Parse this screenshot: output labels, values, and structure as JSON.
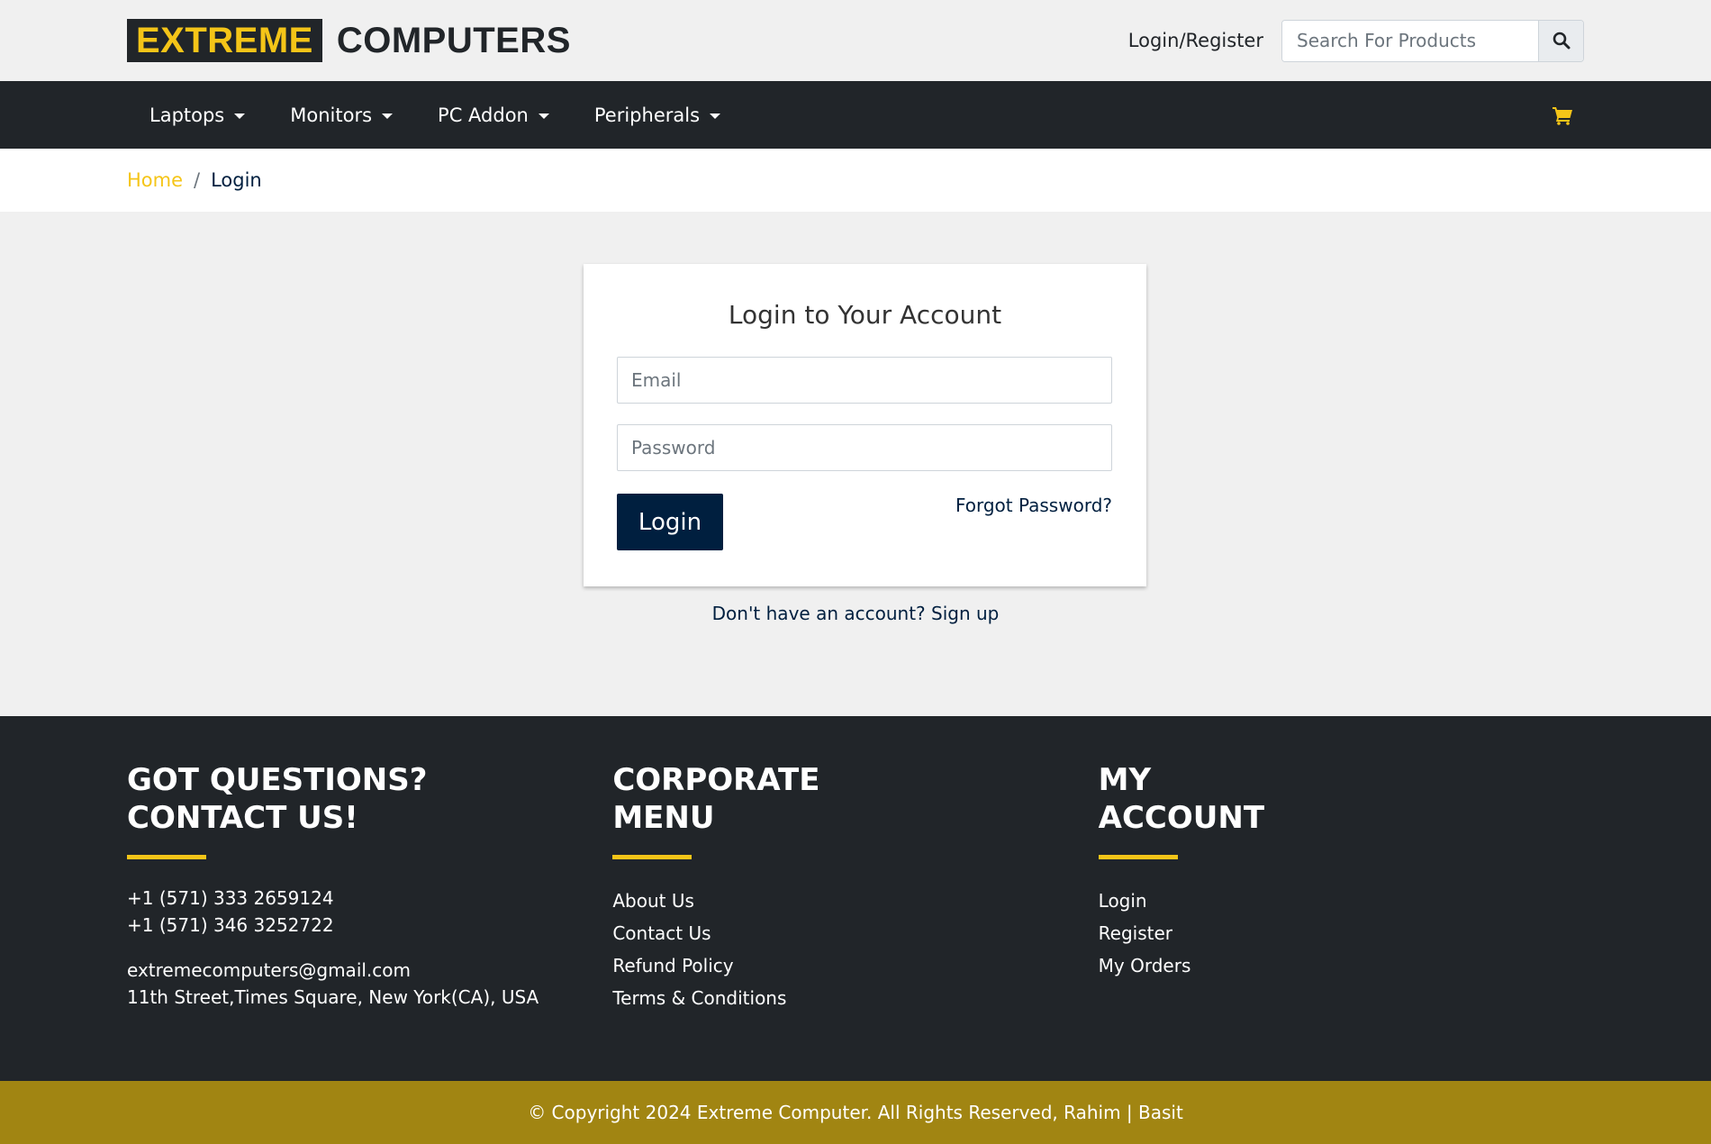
{
  "header": {
    "logo_highlight": "EXTREME",
    "logo_text": "COMPUTERS",
    "login_register": "Login/Register",
    "search_placeholder": "Search For Products"
  },
  "nav": {
    "items": [
      {
        "label": "Laptops"
      },
      {
        "label": "Monitors"
      },
      {
        "label": "PC Addon"
      },
      {
        "label": "Peripherals"
      }
    ],
    "cart_color": "#f5c518"
  },
  "breadcrumb": {
    "home": "Home",
    "separator": "/",
    "current": "Login"
  },
  "login": {
    "title": "Login to Your Account",
    "email_placeholder": "Email",
    "password_placeholder": "Password",
    "button_label": "Login",
    "forgot": "Forgot Password?",
    "signup_prompt": "Don't have an account? Sign up"
  },
  "footer": {
    "contact": {
      "heading_line1": "GOT QUESTIONS?",
      "heading_line2": "CONTACT US!",
      "phone1": "+1 (571) 333 2659124",
      "phone2": "+1 (571) 346 3252722",
      "email": "extremecomputers@gmail.com",
      "address": "11th Street,Times Square, New York(CA), USA"
    },
    "corporate": {
      "heading_line1": "CORPORATE",
      "heading_line2": "MENU",
      "links": [
        "About Us",
        "Contact Us",
        "Refund Policy",
        "Terms & Conditions"
      ]
    },
    "account": {
      "heading_line1": "MY",
      "heading_line2": "ACCOUNT",
      "links": [
        "Login",
        "Register",
        "My Orders"
      ]
    },
    "copyright": "© Copyright 2024 Extreme Computer. All Rights Reserved, Rahim | Basit"
  },
  "colors": {
    "accent": "#f5c518",
    "dark": "#212529",
    "navy": "#001f3f",
    "copyright_bg": "#a18512"
  }
}
